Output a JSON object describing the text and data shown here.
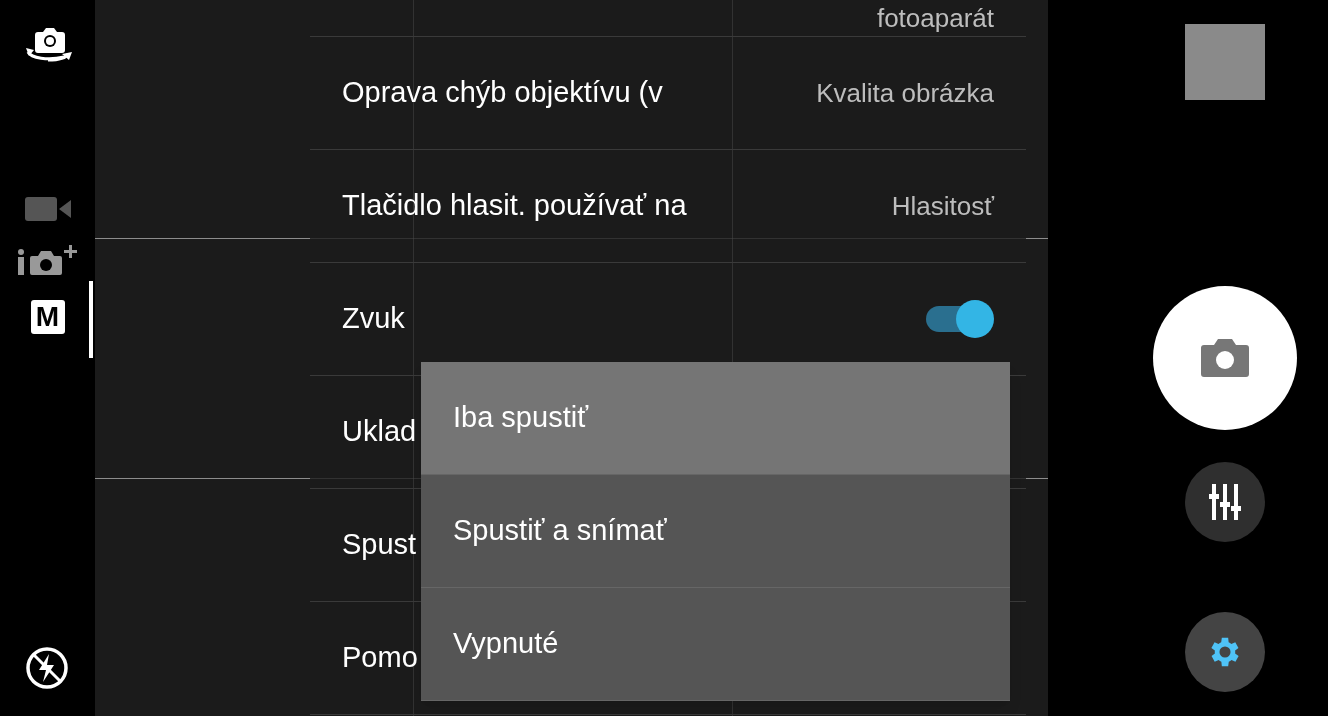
{
  "modes": [
    {
      "kind": "video",
      "selected": false
    },
    {
      "kind": "superior-auto",
      "selected": false
    },
    {
      "kind": "manual",
      "label": "M",
      "selected": true
    }
  ],
  "settings": {
    "rows": [
      {
        "label": "",
        "value": "fotoaparát",
        "kind": "value"
      },
      {
        "label": "Oprava chýb objektívu (v",
        "value": "Kvalita obrázka",
        "kind": "value"
      },
      {
        "label": "Tlačidlo hlasit. používať na",
        "value": "Hlasitosť",
        "kind": "value"
      },
      {
        "label": "Zvuk",
        "kind": "toggle",
        "on": true
      },
      {
        "label": "Uklad",
        "kind": "value"
      },
      {
        "label": "Spust",
        "kind": "value"
      },
      {
        "label": "Pomo",
        "kind": "value"
      }
    ]
  },
  "dropdown": {
    "options": [
      {
        "label": "Iba spustiť",
        "selected": true
      },
      {
        "label": "Spustiť a snímať",
        "selected": false
      },
      {
        "label": "Vypnuté",
        "selected": false
      }
    ]
  }
}
